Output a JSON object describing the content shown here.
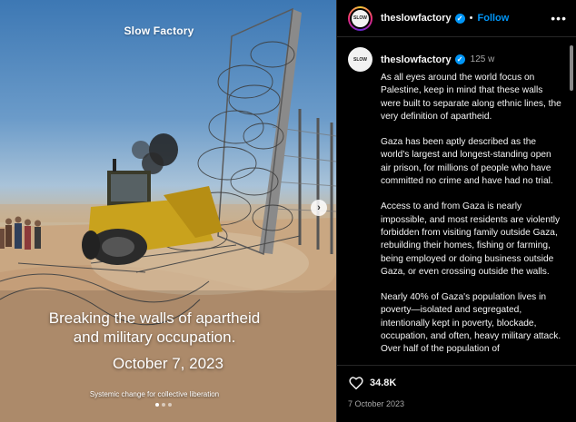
{
  "media": {
    "brand": "Slow Factory",
    "headline_line1": "Breaking the walls of apartheid",
    "headline_line2": "and military occupation.",
    "date": "October 7, 2023",
    "tagline": "Systemic change for collective liberation",
    "next_symbol": "›",
    "slide_dots": 3,
    "active_dot": 1
  },
  "post": {
    "username": "theslowfactory",
    "verified": true,
    "separator": "•",
    "follow_label": "Follow",
    "more_symbol": "•••",
    "avatar_text": "SLOW",
    "age": "125 w",
    "caption": [
      "As all eyes around the world focus on Palestine, keep in mind that these walls were built to separate along ethnic lines, the very definition of apartheid.",
      "Gaza has been aptly described as the world's largest and longest-standing open air prison, for millions of people who have committed no crime and have had no trial.",
      "Access to and from Gaza is nearly impossible, and most residents are violently forbidden from visiting family outside Gaza, rebuilding their homes, fishing or farming, being employed or doing business outside Gaza, or even crossing outside the walls.",
      "Nearly 40% of Gaza's population lives in poverty—isolated and segregated, intentionally kept in poverty, blockade, occupation, and often, heavy military attack. Over half of the population of"
    ],
    "likes": "34.8K",
    "date": "7 October 2023"
  },
  "colors": {
    "accent": "#0095f6",
    "background": "#000000",
    "secondary_text": "#a8a8a8"
  }
}
